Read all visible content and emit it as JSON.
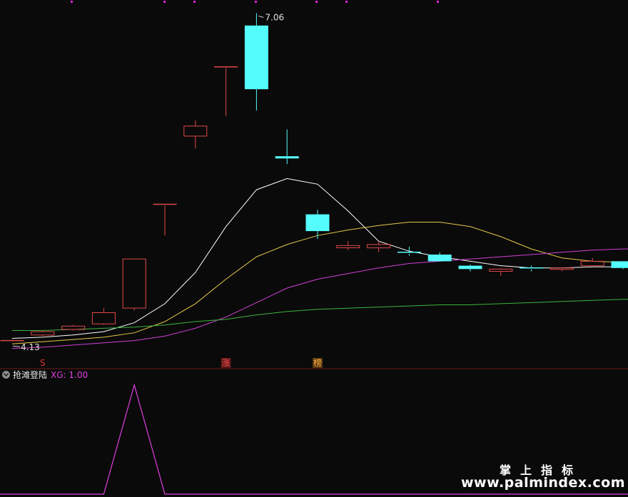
{
  "chart_data": [
    {
      "type": "candlestick",
      "ylim": [
        4.0,
        7.14
      ],
      "price_labels": {
        "max": "7.06",
        "min": "4.13"
      },
      "candles": [
        {
          "o": 4.13,
          "h": 4.14,
          "l": 4.12,
          "c": 4.13,
          "up": true
        },
        {
          "o": 4.18,
          "h": 4.22,
          "l": 4.17,
          "c": 4.21,
          "up": true
        },
        {
          "o": 4.23,
          "h": 4.27,
          "l": 4.22,
          "c": 4.26,
          "up": true
        },
        {
          "o": 4.28,
          "h": 4.42,
          "l": 4.27,
          "c": 4.38,
          "up": true
        },
        {
          "o": 4.42,
          "h": 4.86,
          "l": 4.4,
          "c": 4.86,
          "up": true
        },
        {
          "o": 5.35,
          "h": 5.35,
          "l": 5.07,
          "c": 5.35,
          "up": true
        },
        {
          "o": 5.96,
          "h": 6.1,
          "l": 5.85,
          "c": 6.05,
          "up": true
        },
        {
          "o": 6.58,
          "h": 6.58,
          "l": 6.14,
          "c": 6.58,
          "up": true
        },
        {
          "o": 6.95,
          "h": 7.06,
          "l": 6.19,
          "c": 6.38,
          "up": false
        },
        {
          "o": 5.78,
          "h": 6.02,
          "l": 5.71,
          "c": 5.76,
          "up": false
        },
        {
          "o": 5.26,
          "h": 5.3,
          "l": 5.04,
          "c": 5.11,
          "up": false
        },
        {
          "o": 4.96,
          "h": 5.02,
          "l": 4.94,
          "c": 4.98,
          "up": true
        },
        {
          "o": 4.96,
          "h": 5.02,
          "l": 4.92,
          "c": 4.99,
          "up": true
        },
        {
          "o": 4.92,
          "h": 4.97,
          "l": 4.89,
          "c": 4.92,
          "up": false
        },
        {
          "o": 4.9,
          "h": 4.92,
          "l": 4.85,
          "c": 4.84,
          "up": false
        },
        {
          "o": 4.8,
          "h": 4.81,
          "l": 4.75,
          "c": 4.77,
          "up": false
        },
        {
          "o": 4.75,
          "h": 4.78,
          "l": 4.71,
          "c": 4.77,
          "up": true
        },
        {
          "o": 4.78,
          "h": 4.8,
          "l": 4.75,
          "c": 4.78,
          "up": false
        },
        {
          "o": 4.77,
          "h": 4.78,
          "l": 4.75,
          "c": 4.78,
          "up": true
        },
        {
          "o": 4.8,
          "h": 4.87,
          "l": 4.79,
          "c": 4.84,
          "up": true
        },
        {
          "o": 4.84,
          "h": 4.84,
          "l": 4.77,
          "c": 4.78,
          "up": false
        }
      ],
      "series": [
        {
          "color": "#ffffff",
          "values": [
            4.15,
            4.16,
            4.18,
            4.21,
            4.29,
            4.46,
            4.74,
            5.15,
            5.48,
            5.58,
            5.53,
            5.29,
            5.02,
            4.93,
            4.88,
            4.84,
            4.8,
            4.78,
            4.78,
            4.79,
            4.79
          ]
        },
        {
          "color": "#e6c84a",
          "values": [
            4.1,
            4.12,
            4.14,
            4.16,
            4.2,
            4.3,
            4.46,
            4.68,
            4.88,
            4.99,
            5.07,
            5.12,
            5.16,
            5.19,
            5.19,
            5.15,
            5.06,
            4.95,
            4.87,
            4.84,
            4.83
          ]
        },
        {
          "color": "#d040d8",
          "values": [
            4.06,
            4.07,
            4.09,
            4.11,
            4.13,
            4.17,
            4.24,
            4.34,
            4.47,
            4.6,
            4.68,
            4.73,
            4.78,
            4.82,
            4.84,
            4.86,
            4.88,
            4.9,
            4.92,
            4.94,
            4.95
          ]
        },
        {
          "color": "#3cb43c",
          "values": [
            4.22,
            4.22,
            4.23,
            4.24,
            4.25,
            4.27,
            4.3,
            4.32,
            4.36,
            4.39,
            4.41,
            4.42,
            4.43,
            4.44,
            4.45,
            4.45,
            4.46,
            4.47,
            4.48,
            4.49,
            4.5
          ]
        }
      ],
      "markers": [
        {
          "index": 1,
          "text": "S",
          "color": "#e03030"
        },
        {
          "index": 7,
          "text": "涨",
          "color": "#ff5050",
          "bg": "#5a1818"
        },
        {
          "index": 10,
          "text": "榜",
          "color": "#ffb040",
          "bg": "#5a3a10"
        }
      ],
      "up_color": "#e04848",
      "down_color": "#54fcfc"
    },
    {
      "type": "line",
      "title": "抢滩登陆",
      "value_label": "XG: 1.00",
      "color": "#e040e0",
      "values": [
        0,
        0,
        0,
        0,
        1,
        0,
        0,
        0,
        0,
        0,
        0,
        0,
        0,
        0,
        0,
        0,
        0,
        0,
        0,
        0,
        0
      ],
      "ylim": [
        0,
        1
      ]
    }
  ],
  "watermark": {
    "title": "掌上指标",
    "url": "www.palmindex.com"
  }
}
